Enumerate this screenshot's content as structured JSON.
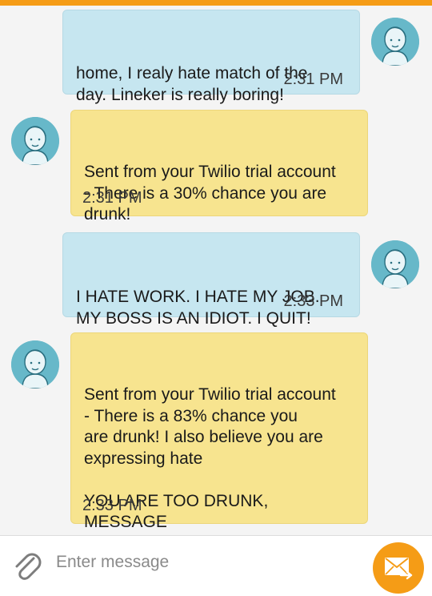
{
  "colors": {
    "accent": "#f59c16",
    "outgoing_bubble": "#c6e6f0",
    "incoming_bubble": "#f7e48f",
    "avatar": "#67b8c9",
    "background": "#f4f4f4"
  },
  "messages": [
    {
      "direction": "outgoing",
      "text": "home, I realy hate match of the\nday. Lineker is really boring!",
      "time": "2:31 PM",
      "avatar_icon": "user-avatar-icon"
    },
    {
      "direction": "incoming",
      "text": "Sent from your Twilio trial account\n- There is a 30% chance you are\ndrunk!",
      "time": "2:31 PM",
      "avatar_icon": "user-avatar-icon"
    },
    {
      "direction": "outgoing",
      "text": "I HATE WORK. I HATE MY JOB.\nMY BOSS IS AN IDIOT. I QUIT!",
      "time": "2:33 PM",
      "avatar_icon": "user-avatar-icon"
    },
    {
      "direction": "incoming",
      "text": "Sent from your Twilio trial account\n- There is a 83% chance you\nare drunk! I also believe you are\nexpressing hate\n\nYOU ARE TOO DRUNK, MESSAGE\nBLOCKED",
      "time": "2:33 PM",
      "avatar_icon": "user-avatar-icon"
    }
  ],
  "composer": {
    "placeholder": "Enter message",
    "value": "",
    "attach_icon": "paperclip-icon",
    "send_icon": "envelope-send-icon"
  }
}
